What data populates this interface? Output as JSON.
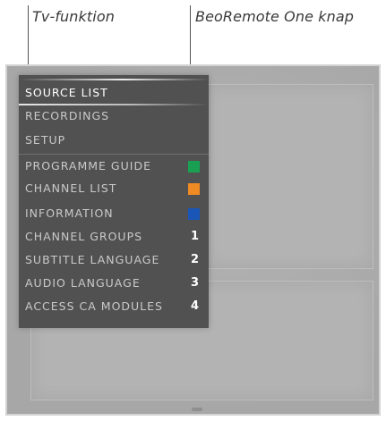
{
  "callouts": {
    "tv_function": "Tv-funktion",
    "remote_button": "BeoRemote One knap"
  },
  "menu": {
    "items": [
      {
        "label": "SOURCE LIST",
        "key": "",
        "key_color": "",
        "selected": true
      },
      {
        "label": "RECORDINGS",
        "key": "",
        "key_color": "",
        "selected": false
      },
      {
        "label": "SETUP",
        "key": "",
        "key_color": "",
        "selected": false
      },
      {
        "label": "PROGRAMME GUIDE",
        "key": "",
        "key_color": "#1aa052",
        "selected": false
      },
      {
        "label": "CHANNEL LIST",
        "key": "",
        "key_color": "#f08a24",
        "selected": false
      },
      {
        "label": "INFORMATION",
        "key": "",
        "key_color": "#1a56b8",
        "selected": false
      },
      {
        "label": "CHANNEL GROUPS",
        "key": "1",
        "key_color": "",
        "selected": false
      },
      {
        "label": "SUBTITLE LANGUAGE",
        "key": "2",
        "key_color": "",
        "selected": false
      },
      {
        "label": "AUDIO LANGUAGE",
        "key": "3",
        "key_color": "",
        "selected": false
      },
      {
        "label": "ACCESS CA MODULES",
        "key": "4",
        "key_color": "",
        "selected": false
      }
    ]
  }
}
